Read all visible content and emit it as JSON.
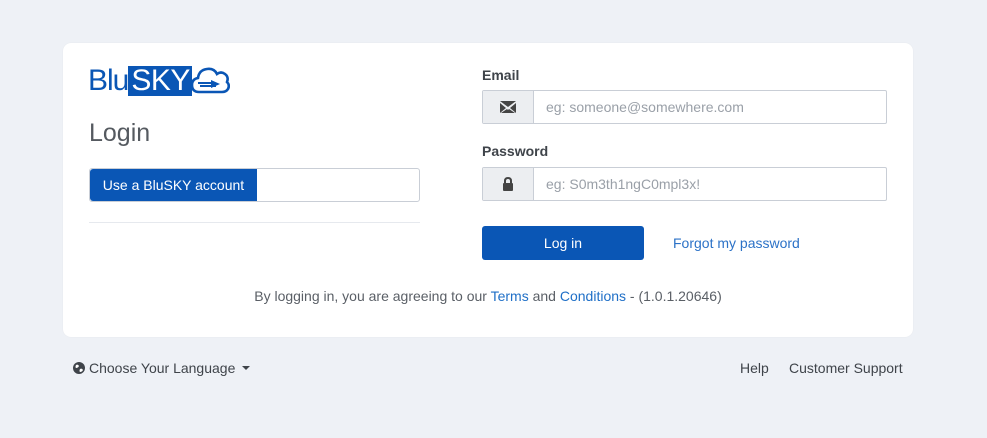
{
  "brand": {
    "logo_part1": "Blu",
    "logo_part2": "SKY",
    "accent_color": "#0a56b5"
  },
  "login": {
    "title": "Login",
    "account_button": "Use a BluSKY account"
  },
  "form": {
    "email_label": "Email",
    "email_placeholder": "eg: someone@somewhere.com",
    "email_icon": "envelope-icon",
    "password_label": "Password",
    "password_placeholder": "eg: S0m3th1ngC0mpl3x!",
    "password_icon": "lock-icon",
    "login_button": "Log in",
    "forgot_link": "Forgot my password"
  },
  "terms": {
    "prefix": "By logging in, you are agreeing to our ",
    "terms_link": "Terms",
    "and": " and ",
    "conditions_link": "Conditions",
    "version": " - (1.0.1.20646)"
  },
  "footer": {
    "language_label": "Choose Your Language",
    "language_icon": "globe-icon",
    "help_link": "Help",
    "support_link": "Customer Support"
  }
}
